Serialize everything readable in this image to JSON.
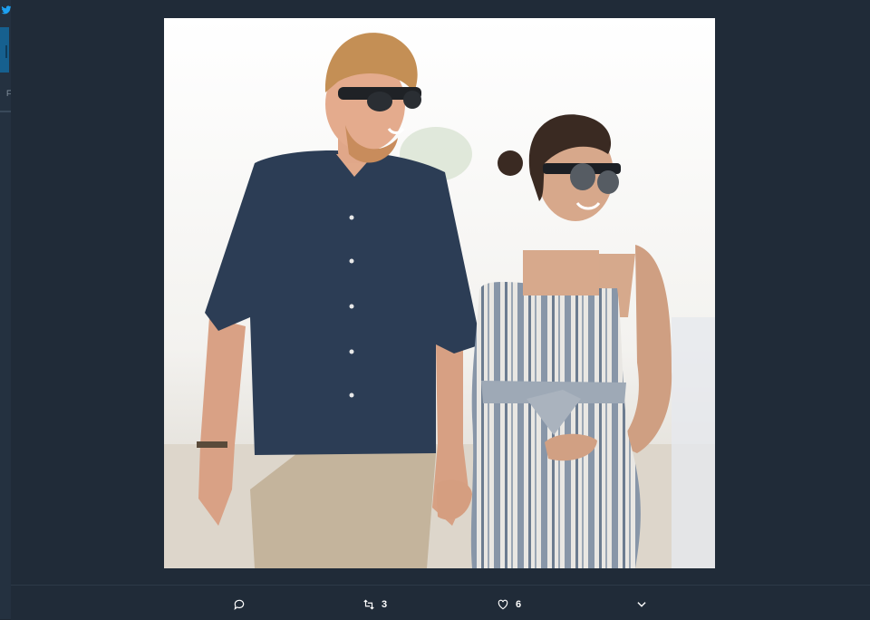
{
  "background_color": "#1f2834",
  "sidebar": {
    "icon": "bird-icon",
    "label": "F"
  },
  "photo": {
    "icon": "photo"
  },
  "actions": {
    "reply": {
      "icon": "reply-icon"
    },
    "retweet": {
      "icon": "retweet-icon",
      "count": "3"
    },
    "like": {
      "icon": "heart-icon",
      "count": "6"
    },
    "more": {
      "icon": "chevron-down-icon"
    }
  }
}
